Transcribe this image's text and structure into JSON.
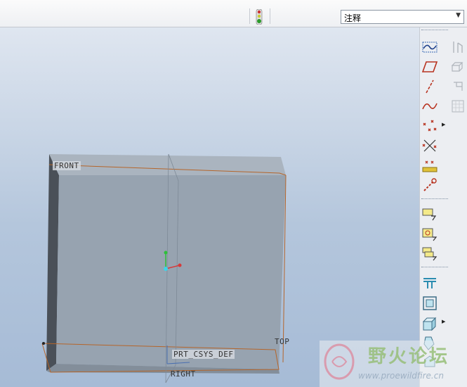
{
  "toolbar": {
    "status_icon": "traffic-light-icon",
    "filter_select": {
      "value": "注释"
    }
  },
  "viewport": {
    "datum_labels": {
      "front": "FRONT",
      "top": "TOP",
      "right": "RIGHT",
      "csys": "PRT_CSYS_DEF"
    }
  },
  "right_toolbar": {
    "tools": [
      "datum-plane-icon",
      "sketch-plane-icon",
      "datum-axis-icon",
      "datum-curve-icon",
      "datum-point-icon",
      "offset-point-icon",
      "field-point-icon",
      "coordinate-system-icon",
      "annotation-note-icon",
      "annotation-feature-icon",
      "annotation-set-icon",
      "hole-icon",
      "shell-icon",
      "draft-icon",
      "round-icon"
    ]
  },
  "watermark": {
    "title": "野火论坛",
    "url": "www.proewildfire.cn"
  },
  "colors": {
    "datum_edge": "#b5652a",
    "solid_face": "#97a3b0",
    "panel_bg": "#eceef2"
  }
}
